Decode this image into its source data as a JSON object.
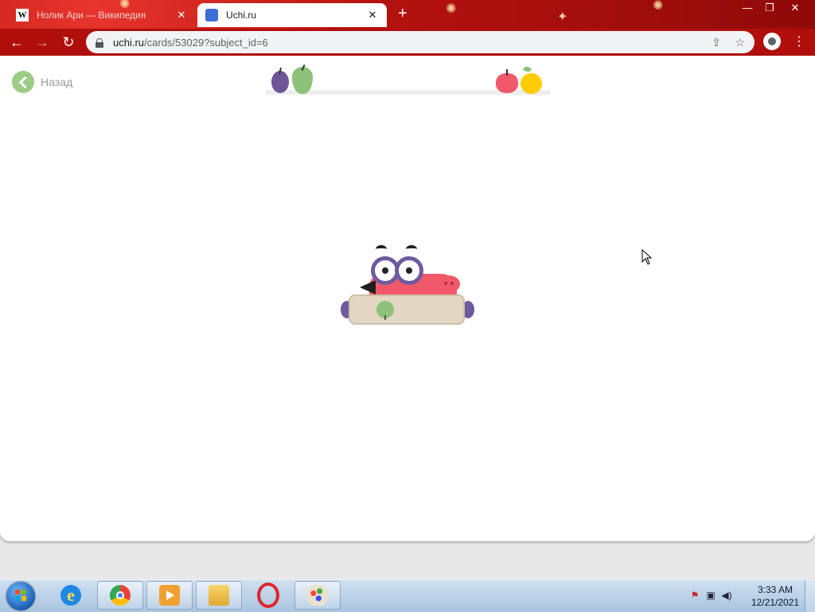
{
  "browser": {
    "tabs": [
      {
        "title": "Нолик Ари — Википедия",
        "icon": "W",
        "active": false
      },
      {
        "title": "Uchi.ru",
        "icon": "",
        "active": true
      }
    ],
    "new_tab_symbol": "+",
    "window_controls": {
      "minimize": "—",
      "maximize": "❐",
      "close": "✕"
    },
    "url_host": "uchi.ru",
    "url_path": "/cards/53029?subject_id=6",
    "theme_color": "#b00f0c"
  },
  "page": {
    "back_label": "Назад",
    "progress_fruits": [
      "plum",
      "pear",
      "apple",
      "lemon"
    ],
    "card_fruit": "green-apple",
    "colors": {
      "accent_green": "#9ccc86",
      "mascot_red": "#f1596a",
      "mascot_purple": "#6f5a9e"
    }
  },
  "taskbar": {
    "apps": [
      "internet-explorer",
      "chrome",
      "media-player",
      "windows-explorer",
      "opera",
      "paint"
    ],
    "time": "3:33 AM",
    "date": "12/21/2021"
  }
}
